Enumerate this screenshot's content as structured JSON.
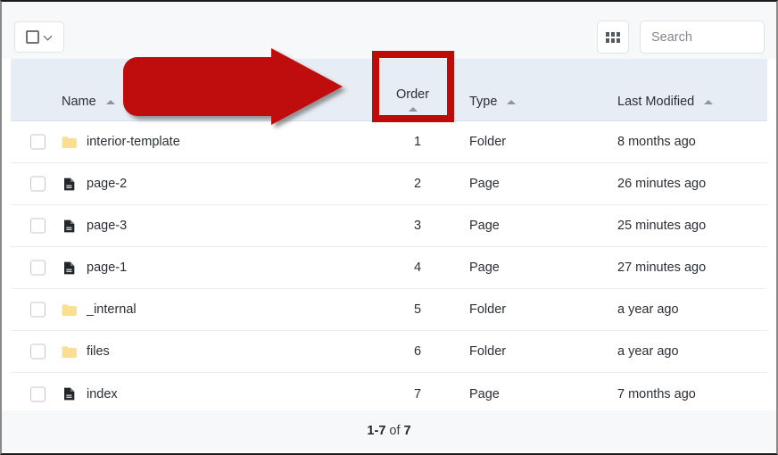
{
  "toolbar": {
    "select_all_label": "select-all-dropdown",
    "select_all_checkbox_icon": "checkbox-icon",
    "select_all_caret_icon": "chevron-down-icon",
    "grid_view_icon": "grid-view-icon",
    "search_placeholder": "Search",
    "search_value": ""
  },
  "table": {
    "columns": [
      {
        "key": "name",
        "label": "Name",
        "sort": "asc",
        "sort_icon": "sort-ascending-icon"
      },
      {
        "key": "order",
        "label": "Order",
        "sort": "asc",
        "sort_icon": "sort-ascending-icon"
      },
      {
        "key": "type",
        "label": "Type",
        "sort": "asc",
        "sort_icon": "sort-ascending-icon"
      },
      {
        "key": "mod",
        "label": "Last Modified",
        "sort": "asc",
        "sort_icon": "sort-ascending-icon"
      }
    ],
    "rows": [
      {
        "name": "interior-template",
        "icon": "folder-icon",
        "order": "1",
        "type": "Folder",
        "modified": "8 months ago"
      },
      {
        "name": "page-2",
        "icon": "page-icon",
        "order": "2",
        "type": "Page",
        "modified": "26 minutes ago"
      },
      {
        "name": "page-3",
        "icon": "page-icon",
        "order": "3",
        "type": "Page",
        "modified": "25 minutes ago"
      },
      {
        "name": "page-1",
        "icon": "page-icon",
        "order": "4",
        "type": "Page",
        "modified": "27 minutes ago"
      },
      {
        "name": "_internal",
        "icon": "folder-icon",
        "order": "5",
        "type": "Folder",
        "modified": "a year ago"
      },
      {
        "name": "files",
        "icon": "folder-icon",
        "order": "6",
        "type": "Folder",
        "modified": "a year ago"
      },
      {
        "name": "index",
        "icon": "page-icon",
        "order": "7",
        "type": "Page",
        "modified": "7 months ago"
      }
    ]
  },
  "footer": {
    "range": "1-7",
    "of": "of",
    "total": "7"
  },
  "annotation": {
    "arrow_icon": "red-arrow-pointing-right",
    "highlight_icon": "red-highlight-rectangle",
    "color": "#bf0a0a",
    "target_column": "Order"
  },
  "colors": {
    "header_row_bg": "#e7edf5",
    "toolbar_bg": "#f7f8fa",
    "folder_icon": "#fade94",
    "page_icon": "#22262b",
    "annotation_red": "#bf0a0a"
  }
}
